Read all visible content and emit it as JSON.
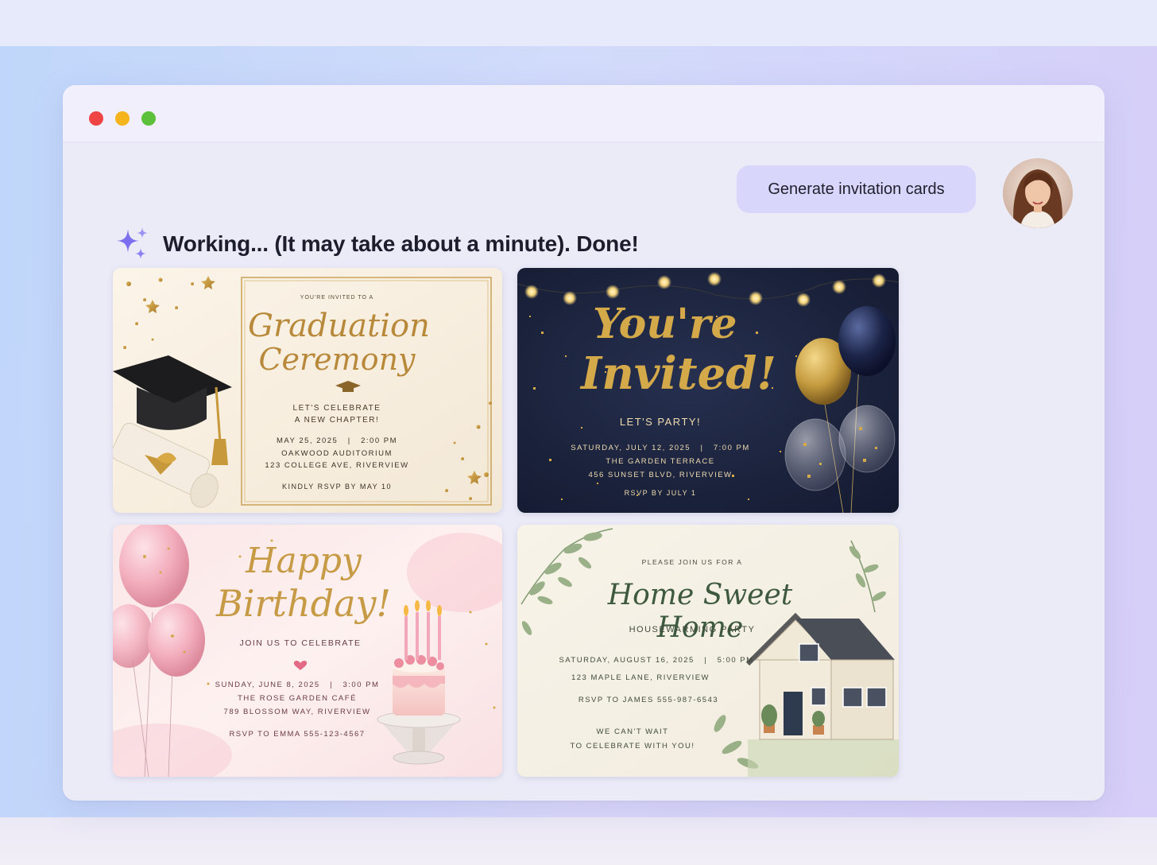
{
  "window": {
    "controls": [
      "close",
      "minimize",
      "maximize"
    ]
  },
  "chat": {
    "user_message": "Generate invitation cards",
    "assistant_status": "Working... (It may take about a minute). Done!",
    "sparkle_icon": "sparkle-icon"
  },
  "cards": {
    "graduation": {
      "intro": "YOU'RE INVITED TO A",
      "title_line1": "Graduation",
      "title_line2": "Ceremony",
      "tagline1": "LET'S CELEBRATE",
      "tagline2": "A NEW CHAPTER!",
      "date_time": "MAY 25, 2025   |   2:00 PM",
      "venue": "OAKWOOD AUDITORIUM",
      "address": "123 COLLEGE AVE, RIVERVIEW",
      "rsvp": "KINDLY RSVP BY MAY 10"
    },
    "party": {
      "title_line1": "You're",
      "title_line2": "Invited!",
      "tagline": "LET'S PARTY!",
      "date_time": "SATURDAY, JULY 12, 2025   |   7:00 PM",
      "venue": "THE GARDEN TERRACE",
      "address": "456 SUNSET BLVD, RIVERVIEW",
      "rsvp": "RSVP BY JULY 1"
    },
    "birthday": {
      "title_line1": "Happy",
      "title_line2": "Birthday!",
      "tagline": "JOIN US TO CELEBRATE",
      "date_time": "SUNDAY, JUNE 8, 2025   |   3:00 PM",
      "venue": "THE ROSE GARDEN CAFÉ",
      "address": "789 BLOSSOM WAY, RIVERVIEW",
      "rsvp": "RSVP TO EMMA 555-123-4567"
    },
    "housewarming": {
      "intro": "PLEASE JOIN US FOR A",
      "title": "Home Sweet Home",
      "subtitle": "HOUSEWARMING PARTY",
      "date_time": "SATURDAY, AUGUST 16, 2025   |   5:00 PM",
      "address": "123 MAPLE LANE, RIVERVIEW",
      "rsvp": "RSVP TO JAMES 555-987-6543",
      "closing1": "WE CAN'T WAIT",
      "closing2": "TO CELEBRATE WITH YOU!"
    }
  },
  "colors": {
    "gold": "#b8893a",
    "navy": "#1c2340",
    "pink_text": "#7a3a44",
    "green_text": "#3e5a3e"
  }
}
